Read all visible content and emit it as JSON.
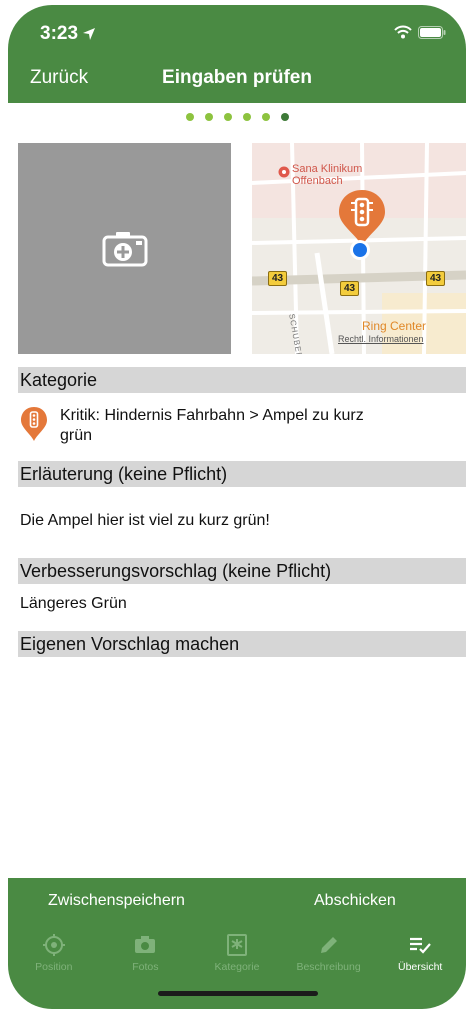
{
  "status": {
    "time": "3:23"
  },
  "nav": {
    "back_label": "Zurück",
    "title": "Eingaben prüfen"
  },
  "map": {
    "poi_clinic": "Sana Klinikum Offenbach",
    "road_label": "43",
    "street": "SCHUBERTSTR.",
    "poi_center": "Ring Center",
    "legal": "Rechtl. Informationen"
  },
  "sections": {
    "kategorie": "Kategorie",
    "erlaeuterung": "Erläuterung (keine Pflicht)",
    "verbesserung": "Verbesserungsvorschlag (keine Pflicht)",
    "eigener": "Eigenen Vorschlag machen"
  },
  "category": {
    "text": "Kritik: Hindernis Fahrbahn > Ampel zu kurz grün",
    "icon": "traffic-light-icon"
  },
  "explanation": "Die Ampel hier ist viel zu kurz grün!",
  "suggestion": "Längeres Grün",
  "actions": {
    "save": "Zwischenspeichern",
    "send": "Abschicken"
  },
  "tabs": [
    {
      "label": "Position",
      "icon": "crosshair-icon"
    },
    {
      "label": "Fotos",
      "icon": "camera-icon"
    },
    {
      "label": "Kategorie",
      "icon": "category-icon"
    },
    {
      "label": "Beschreibung",
      "icon": "pencil-icon"
    },
    {
      "label": "Übersicht",
      "icon": "checklist-icon"
    }
  ],
  "colors": {
    "primary": "#4a8a43",
    "dot": "#8dc33f",
    "pin": "#e4783a",
    "section": "#d6d6d6"
  }
}
